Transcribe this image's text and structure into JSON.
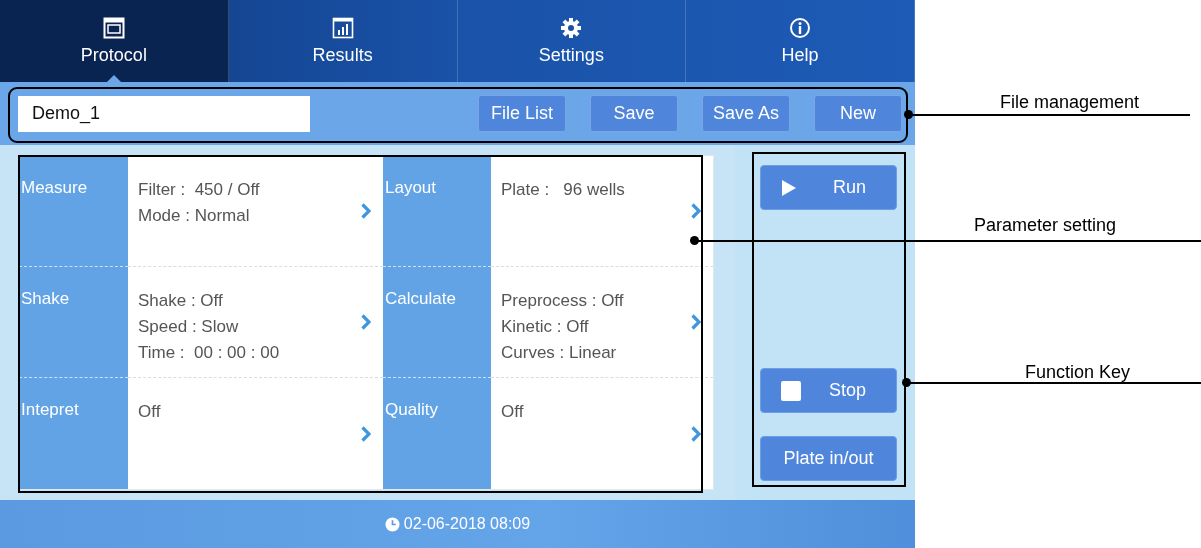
{
  "tabs": [
    {
      "label": "Protocol",
      "selected": true
    },
    {
      "label": "Results",
      "selected": false
    },
    {
      "label": "Settings",
      "selected": false
    },
    {
      "label": "Help",
      "selected": false
    }
  ],
  "file_bar": {
    "file_name": "Demo_1",
    "buttons": [
      "File List",
      "Save",
      "Save As",
      "New"
    ]
  },
  "parameters": [
    {
      "label": "Measure",
      "lines": [
        "Filter :  450 / Off",
        "Mode : Normal"
      ]
    },
    {
      "label": "Layout",
      "lines": [
        "Plate :   96 wells"
      ]
    },
    {
      "label": "Shake",
      "lines": [
        "Shake : Off",
        "Speed : Slow",
        "Time :  00 : 00 : 00"
      ]
    },
    {
      "label": "Calculate",
      "lines": [
        "Preprocess : Off",
        "Kinetic : Off",
        "Curves : Linear"
      ]
    },
    {
      "label": "Intepret",
      "lines": [
        "Off"
      ]
    },
    {
      "label": "Quality",
      "lines": [
        "Off"
      ]
    }
  ],
  "function_keys": [
    {
      "label": "Run",
      "kind": "play"
    },
    {
      "label": "Stop",
      "kind": "stop"
    },
    {
      "label": "Plate in/out",
      "kind": "plain"
    }
  ],
  "status_bar": {
    "datetime": "02-06-2018 08:09"
  },
  "annotations": [
    {
      "label": "File management"
    },
    {
      "label": "Parameter setting"
    },
    {
      "label": "Function Key"
    }
  ]
}
